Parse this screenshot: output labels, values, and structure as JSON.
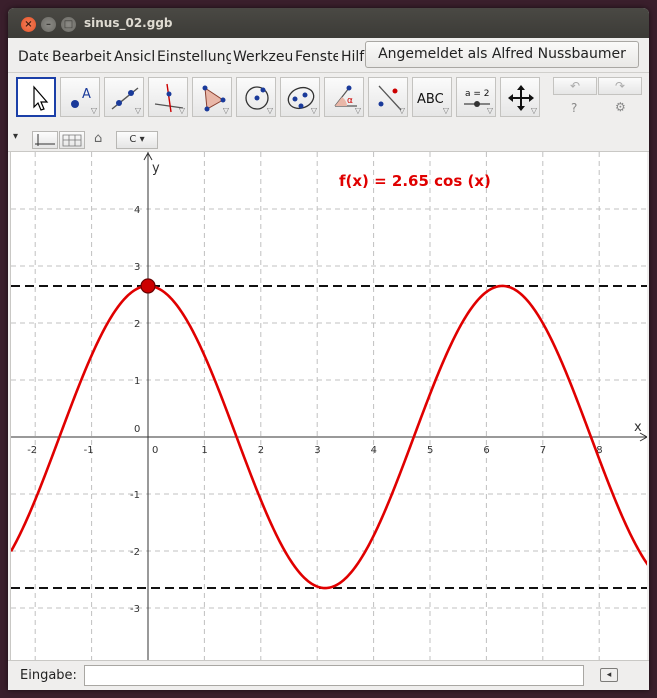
{
  "window": {
    "title": "sinus_02.ggb",
    "buttons": {
      "close": "×",
      "minimize": "–",
      "maximize": "□"
    }
  },
  "menu": {
    "items": [
      "Datei",
      "Bearbeiten",
      "Ansicht",
      "Einstellungen",
      "Werkzeuge",
      "Fenster",
      "Hilfe"
    ],
    "login": "Angemeldet als Alfred Nussbaumer"
  },
  "toolbar": {
    "tools": [
      "move-tool",
      "point-tool",
      "line-tool",
      "perpendicular-line-tool",
      "polygon-tool",
      "circle-tool",
      "ellipse-tool",
      "angle-tool",
      "reflect-tool",
      "text-tool",
      "slider-tool",
      "move-graphics-view-tool"
    ],
    "text_tool_label": "ABC",
    "slider_tool_label": "a = 2",
    "undo": "↶",
    "redo": "↷",
    "help": "?",
    "settings": "⚙"
  },
  "stylebar": {
    "toggle": "▾",
    "home": "⌂",
    "style_menu": "C ▾"
  },
  "graphics": {
    "function_label": "f(x) = 2.65 cos (x)",
    "x_axis_label": "x",
    "y_axis_label": "y",
    "x_ticks": [
      "-2",
      "-1",
      "0",
      "1",
      "2",
      "3",
      "4",
      "5",
      "6",
      "7",
      "8"
    ],
    "y_ticks": [
      "4",
      "3",
      "2",
      "1",
      "0",
      "-1",
      "-2",
      "-3"
    ],
    "curve_color": "#e00000",
    "point_color": "#cc0000"
  },
  "chart_data": {
    "type": "line",
    "function": "2.65*cos(x)",
    "amplitude": 2.65,
    "xlim": [
      -2.5,
      8.8
    ],
    "ylim": [
      -4,
      4.8
    ],
    "grid": true,
    "series": [
      {
        "name": "f(x) = 2.65 cos (x)",
        "color": "#e00000"
      }
    ],
    "horizontal_lines": [
      2.65,
      -2.65
    ],
    "point": [
      0,
      2.65
    ]
  },
  "input": {
    "label": "Eingabe:",
    "value": "",
    "placeholder": "",
    "help": "◂"
  }
}
